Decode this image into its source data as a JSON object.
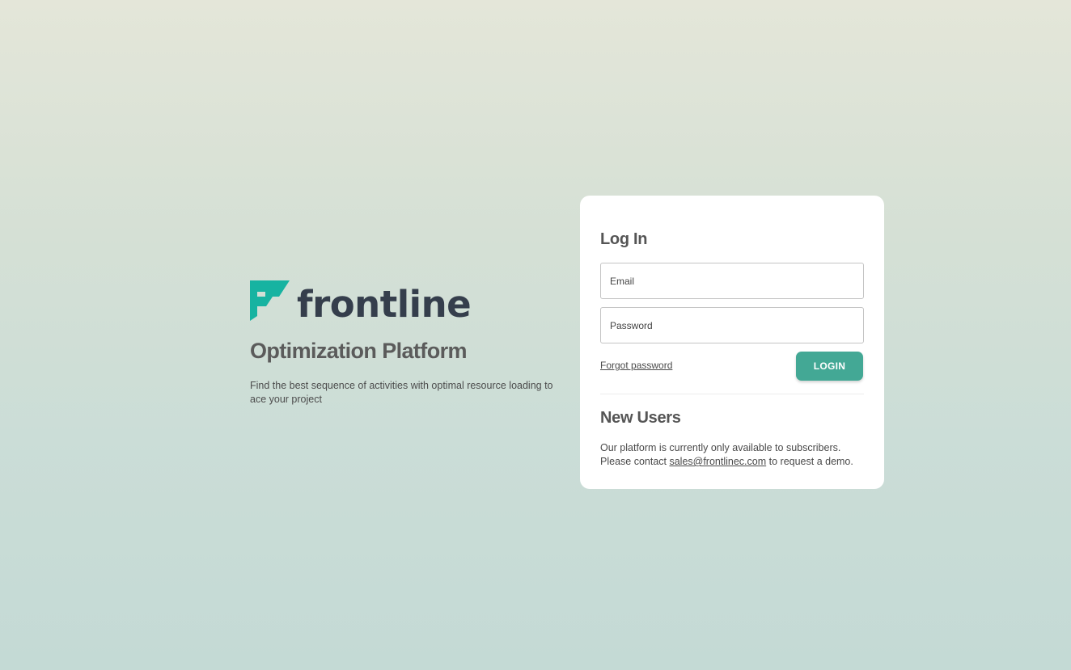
{
  "brand": {
    "logo_text": "frontline",
    "title": "Optimization Platform",
    "tagline": "Find the best sequence of activities with optimal resource loading to ace your project",
    "logo_colors": {
      "mark": "#17b3a1",
      "word": "#353e4c"
    }
  },
  "login": {
    "heading": "Log In",
    "email_placeholder": "Email",
    "password_placeholder": "Password",
    "forgot_label": "Forgot password",
    "button_label": "LOGIN",
    "button_color": "#43a895"
  },
  "new_users": {
    "heading": "New Users",
    "line1": "Our platform is currently only available to subscribers.",
    "line2_prefix": "Please contact ",
    "email_link": "sales@frontlinec.com",
    "line2_suffix": " to request a demo."
  }
}
